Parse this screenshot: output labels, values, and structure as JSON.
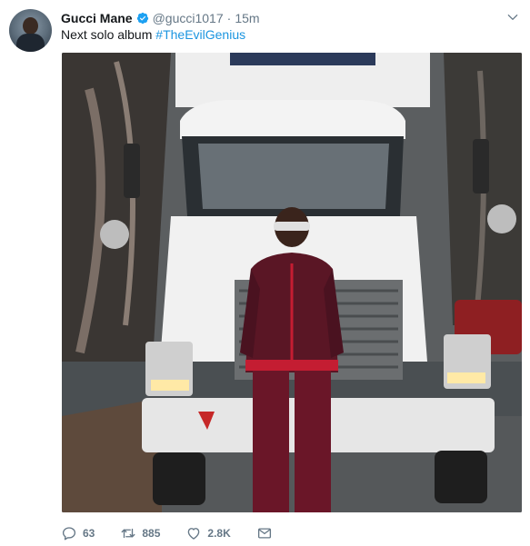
{
  "tweet": {
    "author_name": "Gucci Mane",
    "handle": "@gucci1017",
    "separator": "·",
    "time": "15m",
    "text_prefix": "Next solo album ",
    "hashtag": "#TheEvilGenius"
  },
  "actions": {
    "replies": "63",
    "retweets": "885",
    "likes": "2.8K"
  },
  "colors": {
    "link": "#1b95e0",
    "verified": "#1da1f2",
    "muted": "#657786"
  },
  "icons": {
    "verified": "verified-badge-icon",
    "caret": "chevron-down-icon",
    "reply": "reply-icon",
    "retweet": "retweet-icon",
    "like": "heart-icon",
    "dm": "envelope-icon"
  }
}
